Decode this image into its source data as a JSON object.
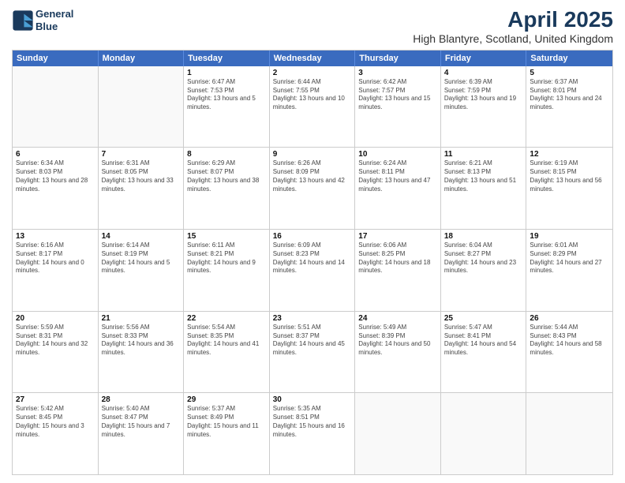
{
  "logo": {
    "line1": "General",
    "line2": "Blue"
  },
  "title": "April 2025",
  "subtitle": "High Blantyre, Scotland, United Kingdom",
  "weekdays": [
    "Sunday",
    "Monday",
    "Tuesday",
    "Wednesday",
    "Thursday",
    "Friday",
    "Saturday"
  ],
  "weeks": [
    [
      {
        "day": "",
        "info": ""
      },
      {
        "day": "",
        "info": ""
      },
      {
        "day": "1",
        "info": "Sunrise: 6:47 AM\nSunset: 7:53 PM\nDaylight: 13 hours and 5 minutes."
      },
      {
        "day": "2",
        "info": "Sunrise: 6:44 AM\nSunset: 7:55 PM\nDaylight: 13 hours and 10 minutes."
      },
      {
        "day": "3",
        "info": "Sunrise: 6:42 AM\nSunset: 7:57 PM\nDaylight: 13 hours and 15 minutes."
      },
      {
        "day": "4",
        "info": "Sunrise: 6:39 AM\nSunset: 7:59 PM\nDaylight: 13 hours and 19 minutes."
      },
      {
        "day": "5",
        "info": "Sunrise: 6:37 AM\nSunset: 8:01 PM\nDaylight: 13 hours and 24 minutes."
      }
    ],
    [
      {
        "day": "6",
        "info": "Sunrise: 6:34 AM\nSunset: 8:03 PM\nDaylight: 13 hours and 28 minutes."
      },
      {
        "day": "7",
        "info": "Sunrise: 6:31 AM\nSunset: 8:05 PM\nDaylight: 13 hours and 33 minutes."
      },
      {
        "day": "8",
        "info": "Sunrise: 6:29 AM\nSunset: 8:07 PM\nDaylight: 13 hours and 38 minutes."
      },
      {
        "day": "9",
        "info": "Sunrise: 6:26 AM\nSunset: 8:09 PM\nDaylight: 13 hours and 42 minutes."
      },
      {
        "day": "10",
        "info": "Sunrise: 6:24 AM\nSunset: 8:11 PM\nDaylight: 13 hours and 47 minutes."
      },
      {
        "day": "11",
        "info": "Sunrise: 6:21 AM\nSunset: 8:13 PM\nDaylight: 13 hours and 51 minutes."
      },
      {
        "day": "12",
        "info": "Sunrise: 6:19 AM\nSunset: 8:15 PM\nDaylight: 13 hours and 56 minutes."
      }
    ],
    [
      {
        "day": "13",
        "info": "Sunrise: 6:16 AM\nSunset: 8:17 PM\nDaylight: 14 hours and 0 minutes."
      },
      {
        "day": "14",
        "info": "Sunrise: 6:14 AM\nSunset: 8:19 PM\nDaylight: 14 hours and 5 minutes."
      },
      {
        "day": "15",
        "info": "Sunrise: 6:11 AM\nSunset: 8:21 PM\nDaylight: 14 hours and 9 minutes."
      },
      {
        "day": "16",
        "info": "Sunrise: 6:09 AM\nSunset: 8:23 PM\nDaylight: 14 hours and 14 minutes."
      },
      {
        "day": "17",
        "info": "Sunrise: 6:06 AM\nSunset: 8:25 PM\nDaylight: 14 hours and 18 minutes."
      },
      {
        "day": "18",
        "info": "Sunrise: 6:04 AM\nSunset: 8:27 PM\nDaylight: 14 hours and 23 minutes."
      },
      {
        "day": "19",
        "info": "Sunrise: 6:01 AM\nSunset: 8:29 PM\nDaylight: 14 hours and 27 minutes."
      }
    ],
    [
      {
        "day": "20",
        "info": "Sunrise: 5:59 AM\nSunset: 8:31 PM\nDaylight: 14 hours and 32 minutes."
      },
      {
        "day": "21",
        "info": "Sunrise: 5:56 AM\nSunset: 8:33 PM\nDaylight: 14 hours and 36 minutes."
      },
      {
        "day": "22",
        "info": "Sunrise: 5:54 AM\nSunset: 8:35 PM\nDaylight: 14 hours and 41 minutes."
      },
      {
        "day": "23",
        "info": "Sunrise: 5:51 AM\nSunset: 8:37 PM\nDaylight: 14 hours and 45 minutes."
      },
      {
        "day": "24",
        "info": "Sunrise: 5:49 AM\nSunset: 8:39 PM\nDaylight: 14 hours and 50 minutes."
      },
      {
        "day": "25",
        "info": "Sunrise: 5:47 AM\nSunset: 8:41 PM\nDaylight: 14 hours and 54 minutes."
      },
      {
        "day": "26",
        "info": "Sunrise: 5:44 AM\nSunset: 8:43 PM\nDaylight: 14 hours and 58 minutes."
      }
    ],
    [
      {
        "day": "27",
        "info": "Sunrise: 5:42 AM\nSunset: 8:45 PM\nDaylight: 15 hours and 3 minutes."
      },
      {
        "day": "28",
        "info": "Sunrise: 5:40 AM\nSunset: 8:47 PM\nDaylight: 15 hours and 7 minutes."
      },
      {
        "day": "29",
        "info": "Sunrise: 5:37 AM\nSunset: 8:49 PM\nDaylight: 15 hours and 11 minutes."
      },
      {
        "day": "30",
        "info": "Sunrise: 5:35 AM\nSunset: 8:51 PM\nDaylight: 15 hours and 16 minutes."
      },
      {
        "day": "",
        "info": ""
      },
      {
        "day": "",
        "info": ""
      },
      {
        "day": "",
        "info": ""
      }
    ]
  ]
}
